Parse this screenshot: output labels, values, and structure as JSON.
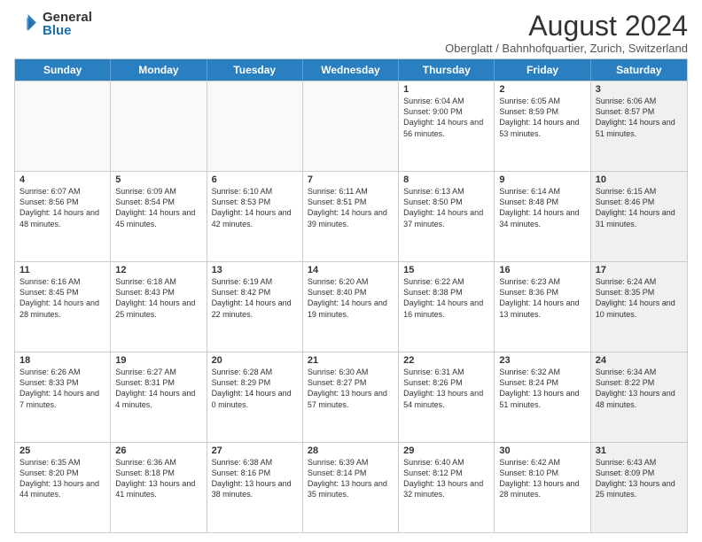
{
  "logo": {
    "general": "General",
    "blue": "Blue"
  },
  "title": "August 2024",
  "subtitle": "Oberglatt / Bahnhofquartier, Zurich, Switzerland",
  "headers": [
    "Sunday",
    "Monday",
    "Tuesday",
    "Wednesday",
    "Thursday",
    "Friday",
    "Saturday"
  ],
  "rows": [
    [
      {
        "day": "",
        "text": "",
        "empty": true
      },
      {
        "day": "",
        "text": "",
        "empty": true
      },
      {
        "day": "",
        "text": "",
        "empty": true
      },
      {
        "day": "",
        "text": "",
        "empty": true
      },
      {
        "day": "1",
        "text": "Sunrise: 6:04 AM\nSunset: 9:00 PM\nDaylight: 14 hours and 56 minutes."
      },
      {
        "day": "2",
        "text": "Sunrise: 6:05 AM\nSunset: 8:59 PM\nDaylight: 14 hours and 53 minutes."
      },
      {
        "day": "3",
        "text": "Sunrise: 6:06 AM\nSunset: 8:57 PM\nDaylight: 14 hours and 51 minutes.",
        "shaded": true
      }
    ],
    [
      {
        "day": "4",
        "text": "Sunrise: 6:07 AM\nSunset: 8:56 PM\nDaylight: 14 hours and 48 minutes."
      },
      {
        "day": "5",
        "text": "Sunrise: 6:09 AM\nSunset: 8:54 PM\nDaylight: 14 hours and 45 minutes."
      },
      {
        "day": "6",
        "text": "Sunrise: 6:10 AM\nSunset: 8:53 PM\nDaylight: 14 hours and 42 minutes."
      },
      {
        "day": "7",
        "text": "Sunrise: 6:11 AM\nSunset: 8:51 PM\nDaylight: 14 hours and 39 minutes."
      },
      {
        "day": "8",
        "text": "Sunrise: 6:13 AM\nSunset: 8:50 PM\nDaylight: 14 hours and 37 minutes."
      },
      {
        "day": "9",
        "text": "Sunrise: 6:14 AM\nSunset: 8:48 PM\nDaylight: 14 hours and 34 minutes."
      },
      {
        "day": "10",
        "text": "Sunrise: 6:15 AM\nSunset: 8:46 PM\nDaylight: 14 hours and 31 minutes.",
        "shaded": true
      }
    ],
    [
      {
        "day": "11",
        "text": "Sunrise: 6:16 AM\nSunset: 8:45 PM\nDaylight: 14 hours and 28 minutes."
      },
      {
        "day": "12",
        "text": "Sunrise: 6:18 AM\nSunset: 8:43 PM\nDaylight: 14 hours and 25 minutes."
      },
      {
        "day": "13",
        "text": "Sunrise: 6:19 AM\nSunset: 8:42 PM\nDaylight: 14 hours and 22 minutes."
      },
      {
        "day": "14",
        "text": "Sunrise: 6:20 AM\nSunset: 8:40 PM\nDaylight: 14 hours and 19 minutes."
      },
      {
        "day": "15",
        "text": "Sunrise: 6:22 AM\nSunset: 8:38 PM\nDaylight: 14 hours and 16 minutes."
      },
      {
        "day": "16",
        "text": "Sunrise: 6:23 AM\nSunset: 8:36 PM\nDaylight: 14 hours and 13 minutes."
      },
      {
        "day": "17",
        "text": "Sunrise: 6:24 AM\nSunset: 8:35 PM\nDaylight: 14 hours and 10 minutes.",
        "shaded": true
      }
    ],
    [
      {
        "day": "18",
        "text": "Sunrise: 6:26 AM\nSunset: 8:33 PM\nDaylight: 14 hours and 7 minutes."
      },
      {
        "day": "19",
        "text": "Sunrise: 6:27 AM\nSunset: 8:31 PM\nDaylight: 14 hours and 4 minutes."
      },
      {
        "day": "20",
        "text": "Sunrise: 6:28 AM\nSunset: 8:29 PM\nDaylight: 14 hours and 0 minutes."
      },
      {
        "day": "21",
        "text": "Sunrise: 6:30 AM\nSunset: 8:27 PM\nDaylight: 13 hours and 57 minutes."
      },
      {
        "day": "22",
        "text": "Sunrise: 6:31 AM\nSunset: 8:26 PM\nDaylight: 13 hours and 54 minutes."
      },
      {
        "day": "23",
        "text": "Sunrise: 6:32 AM\nSunset: 8:24 PM\nDaylight: 13 hours and 51 minutes."
      },
      {
        "day": "24",
        "text": "Sunrise: 6:34 AM\nSunset: 8:22 PM\nDaylight: 13 hours and 48 minutes.",
        "shaded": true
      }
    ],
    [
      {
        "day": "25",
        "text": "Sunrise: 6:35 AM\nSunset: 8:20 PM\nDaylight: 13 hours and 44 minutes."
      },
      {
        "day": "26",
        "text": "Sunrise: 6:36 AM\nSunset: 8:18 PM\nDaylight: 13 hours and 41 minutes."
      },
      {
        "day": "27",
        "text": "Sunrise: 6:38 AM\nSunset: 8:16 PM\nDaylight: 13 hours and 38 minutes."
      },
      {
        "day": "28",
        "text": "Sunrise: 6:39 AM\nSunset: 8:14 PM\nDaylight: 13 hours and 35 minutes."
      },
      {
        "day": "29",
        "text": "Sunrise: 6:40 AM\nSunset: 8:12 PM\nDaylight: 13 hours and 32 minutes."
      },
      {
        "day": "30",
        "text": "Sunrise: 6:42 AM\nSunset: 8:10 PM\nDaylight: 13 hours and 28 minutes."
      },
      {
        "day": "31",
        "text": "Sunrise: 6:43 AM\nSunset: 8:09 PM\nDaylight: 13 hours and 25 minutes.",
        "shaded": true
      }
    ]
  ]
}
